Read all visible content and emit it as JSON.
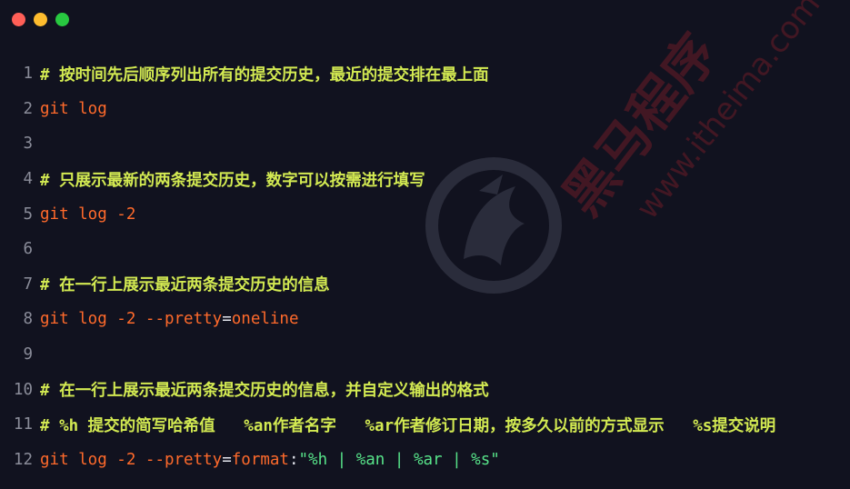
{
  "window": {
    "controls": [
      {
        "name": "close",
        "color": "#ff5f57"
      },
      {
        "name": "minimize",
        "color": "#febc2e"
      },
      {
        "name": "maximize",
        "color": "#28c840"
      }
    ]
  },
  "watermark": {
    "brand": "黑马程序",
    "url": "www.itheima.com"
  },
  "colors": {
    "background": "#11121f",
    "comment": "#d3ea52",
    "keyword": "#ff6a2b",
    "string": "#57e389",
    "line_number": "#8a8c99"
  },
  "code": {
    "lines": [
      {
        "number": "1",
        "tokens": [
          {
            "type": "comment",
            "text": "# 按时间先后顺序列出所有的提交历史，最近的提交排在最上面"
          }
        ]
      },
      {
        "number": "2",
        "tokens": [
          {
            "type": "kw",
            "text": "git log"
          }
        ]
      },
      {
        "number": "3",
        "tokens": []
      },
      {
        "number": "4",
        "tokens": [
          {
            "type": "comment",
            "text": "# 只展示最新的两条提交历史，数字可以按需进行填写"
          }
        ]
      },
      {
        "number": "5",
        "tokens": [
          {
            "type": "kw",
            "text": "git log "
          },
          {
            "type": "kw",
            "text": "-2"
          }
        ]
      },
      {
        "number": "6",
        "tokens": []
      },
      {
        "number": "7",
        "tokens": [
          {
            "type": "comment",
            "text": "# 在一行上展示最近两条提交历史的信息"
          }
        ]
      },
      {
        "number": "8",
        "tokens": [
          {
            "type": "kw",
            "text": "git log "
          },
          {
            "type": "kw",
            "text": "-2 "
          },
          {
            "type": "kw",
            "text": "--pretty"
          },
          {
            "type": "plain",
            "text": "="
          },
          {
            "type": "kw",
            "text": "oneline"
          }
        ]
      },
      {
        "number": "9",
        "tokens": []
      },
      {
        "number": "10",
        "tokens": [
          {
            "type": "comment",
            "text": "# 在一行上展示最近两条提交历史的信息，并自定义输出的格式"
          }
        ]
      },
      {
        "number": "11",
        "tokens": [
          {
            "type": "comment",
            "text": "# %h 提交的简写哈希值   %an作者名字   %ar作者修订日期，按多久以前的方式显示   %s提交说明"
          }
        ]
      },
      {
        "number": "12",
        "tokens": [
          {
            "type": "kw",
            "text": "git log "
          },
          {
            "type": "kw",
            "text": "-2 "
          },
          {
            "type": "kw",
            "text": "--pretty"
          },
          {
            "type": "plain",
            "text": "="
          },
          {
            "type": "kw",
            "text": "format"
          },
          {
            "type": "plain",
            "text": ":"
          },
          {
            "type": "str",
            "text": "\"%h | %an | %ar | %s\""
          }
        ]
      }
    ]
  }
}
